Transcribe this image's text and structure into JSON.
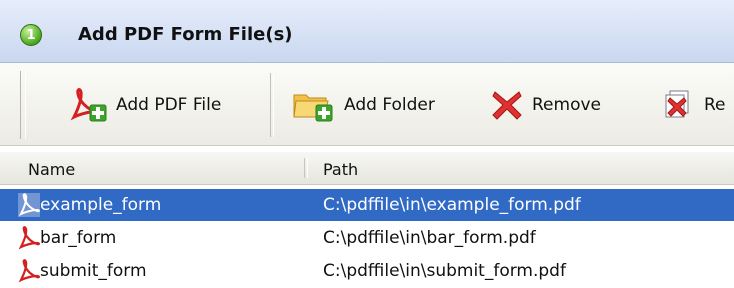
{
  "header": {
    "step_number": "1",
    "title": "Add PDF Form File(s)"
  },
  "toolbar": {
    "add_pdf_label": "Add PDF File",
    "add_folder_label": "Add Folder",
    "remove_label": "Remove",
    "remove_all_label": "Re"
  },
  "list": {
    "columns": {
      "name": "Name",
      "path": "Path"
    },
    "rows": [
      {
        "name": "example_form",
        "path": "C:\\pdffile\\in\\example_form.pdf",
        "selected": true
      },
      {
        "name": "bar_form",
        "path": "C:\\pdffile\\in\\bar_form.pdf",
        "selected": false
      },
      {
        "name": "submit_form",
        "path": "C:\\pdffile\\in\\submit_form.pdf",
        "selected": false
      }
    ]
  },
  "colors": {
    "selection": "#316ac5",
    "header_gradient_top": "#e7eefb",
    "header_gradient_bottom": "#c9d7f0",
    "pdf_red": "#d42020",
    "add_green": "#3aa52a",
    "remove_red": "#e03030"
  },
  "icons": {
    "step": "green-circle-one-icon",
    "add_pdf": "pdf-add-icon",
    "add_folder": "folder-add-icon",
    "remove": "red-x-icon",
    "remove_all": "pages-remove-icon",
    "row": "pdf-file-icon"
  }
}
